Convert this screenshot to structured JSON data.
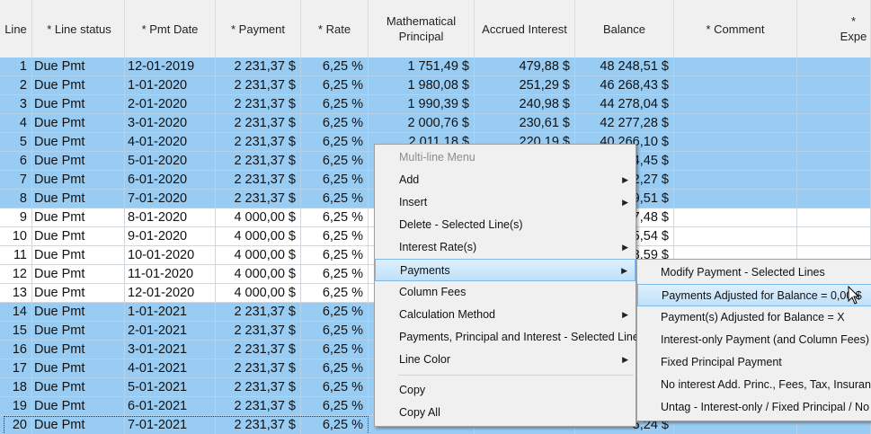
{
  "headers": [
    {
      "key": "line",
      "label": "Line"
    },
    {
      "key": "status",
      "label": "* Line status"
    },
    {
      "key": "date",
      "label": "* Pmt Date"
    },
    {
      "key": "pay",
      "label": "* Payment"
    },
    {
      "key": "rate",
      "label": "* Rate"
    },
    {
      "key": "princ",
      "label": "Mathematical\nPrincipal"
    },
    {
      "key": "int",
      "label": "Accrued Interest"
    },
    {
      "key": "bal",
      "label": "Balance"
    },
    {
      "key": "comm",
      "label": "* Comment"
    },
    {
      "key": "exp",
      "label": "* Expe"
    }
  ],
  "rows": [
    {
      "line": "1",
      "status": "Due Pmt",
      "date": "12-01-2019",
      "pay": "2 231,37 $",
      "rate": "6,25 %",
      "princ": "1 751,49 $",
      "int": "479,88 $",
      "bal": "48 248,51 $",
      "selected": true
    },
    {
      "line": "2",
      "status": "Due Pmt",
      "date": "1-01-2020",
      "pay": "2 231,37 $",
      "rate": "6,25 %",
      "princ": "1 980,08 $",
      "int": "251,29 $",
      "bal": "46 268,43 $",
      "selected": true
    },
    {
      "line": "3",
      "status": "Due Pmt",
      "date": "2-01-2020",
      "pay": "2 231,37 $",
      "rate": "6,25 %",
      "princ": "1 990,39 $",
      "int": "240,98 $",
      "bal": "44 278,04 $",
      "selected": true
    },
    {
      "line": "4",
      "status": "Due Pmt",
      "date": "3-01-2020",
      "pay": "2 231,37 $",
      "rate": "6,25 %",
      "princ": "2 000,76 $",
      "int": "230,61 $",
      "bal": "42 277,28 $",
      "selected": true
    },
    {
      "line": "5",
      "status": "Due Pmt",
      "date": "4-01-2020",
      "pay": "2 231,37 $",
      "rate": "6,25 %",
      "princ": "2 011,18 $",
      "int": "220,19 $",
      "bal": "40 266,10 $",
      "selected": true
    },
    {
      "line": "6",
      "status": "Due Pmt",
      "date": "5-01-2020",
      "pay": "2 231,37 $",
      "rate": "6,25 %",
      "princ": "",
      "int": "",
      "bal": "4,45 $",
      "selected": true
    },
    {
      "line": "7",
      "status": "Due Pmt",
      "date": "6-01-2020",
      "pay": "2 231,37 $",
      "rate": "6,25 %",
      "princ": "",
      "int": "",
      "bal": "2,27 $",
      "selected": true
    },
    {
      "line": "8",
      "status": "Due Pmt",
      "date": "7-01-2020",
      "pay": "2 231,37 $",
      "rate": "6,25 %",
      "princ": "",
      "int": "",
      "bal": "9,51 $",
      "selected": true
    },
    {
      "line": "9",
      "status": "Due Pmt",
      "date": "8-01-2020",
      "pay": "4 000,00 $",
      "rate": "6,25 %",
      "princ": "",
      "int": "",
      "bal": "7,48 $",
      "selected": false
    },
    {
      "line": "10",
      "status": "Due Pmt",
      "date": "9-01-2020",
      "pay": "4 000,00 $",
      "rate": "6,25 %",
      "princ": "",
      "int": "",
      "bal": "5,54 $",
      "selected": false
    },
    {
      "line": "11",
      "status": "Due Pmt",
      "date": "10-01-2020",
      "pay": "4 000,00 $",
      "rate": "6,25 %",
      "princ": "",
      "int": "",
      "bal": "8,59 $",
      "selected": false
    },
    {
      "line": "12",
      "status": "Due Pmt",
      "date": "11-01-2020",
      "pay": "4 000,00 $",
      "rate": "6,25 %",
      "princ": "",
      "int": "",
      "bal": "",
      "selected": false
    },
    {
      "line": "13",
      "status": "Due Pmt",
      "date": "12-01-2020",
      "pay": "4 000,00 $",
      "rate": "6,25 %",
      "princ": "",
      "int": "",
      "bal": "",
      "selected": false
    },
    {
      "line": "14",
      "status": "Due Pmt",
      "date": "1-01-2021",
      "pay": "2 231,37 $",
      "rate": "6,25 %",
      "princ": "",
      "int": "",
      "bal": "",
      "selected": true
    },
    {
      "line": "15",
      "status": "Due Pmt",
      "date": "2-01-2021",
      "pay": "2 231,37 $",
      "rate": "6,25 %",
      "princ": "",
      "int": "",
      "bal": "",
      "selected": true
    },
    {
      "line": "16",
      "status": "Due Pmt",
      "date": "3-01-2021",
      "pay": "2 231,37 $",
      "rate": "6,25 %",
      "princ": "",
      "int": "",
      "bal": "",
      "selected": true
    },
    {
      "line": "17",
      "status": "Due Pmt",
      "date": "4-01-2021",
      "pay": "2 231,37 $",
      "rate": "6,25 %",
      "princ": "",
      "int": "",
      "bal": "",
      "selected": true
    },
    {
      "line": "18",
      "status": "Due Pmt",
      "date": "5-01-2021",
      "pay": "2 231,37 $",
      "rate": "6,25 %",
      "princ": "",
      "int": "",
      "bal": "",
      "selected": true
    },
    {
      "line": "19",
      "status": "Due Pmt",
      "date": "6-01-2021",
      "pay": "2 231,37 $",
      "rate": "6,25 %",
      "princ": "",
      "int": "",
      "bal": "",
      "selected": true
    },
    {
      "line": "20",
      "status": "Due Pmt",
      "date": "7-01-2021",
      "pay": "2 231,37 $",
      "rate": "6,25 %",
      "princ": "",
      "int": "",
      "bal": "5,24 $",
      "selected": true,
      "current": true
    }
  ],
  "context_menu": {
    "items": [
      {
        "label": "Multi-line Menu",
        "disabled": true
      },
      {
        "label": "Add",
        "submenu": true
      },
      {
        "label": "Insert",
        "submenu": true
      },
      {
        "label": "Delete - Selected Line(s)"
      },
      {
        "label": "Interest Rate(s)",
        "submenu": true
      },
      {
        "label": "Payments",
        "submenu": true,
        "highlighted": true
      },
      {
        "label": "Column Fees"
      },
      {
        "label": "Calculation Method",
        "submenu": true
      },
      {
        "label": "Payments, Principal and Interest - Selected Lines"
      },
      {
        "label": "Line Color",
        "submenu": true
      },
      {
        "separator": true
      },
      {
        "label": "Copy"
      },
      {
        "label": "Copy All"
      }
    ]
  },
  "payments_submenu": {
    "items": [
      {
        "label": "Modify Payment - Selected Lines"
      },
      {
        "label": "Payments Adjusted for Balance = 0,00 $",
        "highlighted": true
      },
      {
        "label": "Payment(s) Adjusted for Balance = X"
      },
      {
        "label": "Interest-only Payment (and Column Fees)"
      },
      {
        "label": "Fixed Principal Payment"
      },
      {
        "label": "No interest Add. Princ., Fees, Tax, Insurance,"
      },
      {
        "label": "Untag - Interest-only / Fixed Principal / No In"
      }
    ]
  },
  "icons": {
    "submenu_arrow": "chevron-right-icon",
    "dropdown": "chevron-down-icon",
    "cursor": "mouse-pointer-icon"
  },
  "colors": {
    "selected_row": "#99ccf3",
    "highlight": "#bfe0f9",
    "header_bg": "#f0f0f0"
  }
}
